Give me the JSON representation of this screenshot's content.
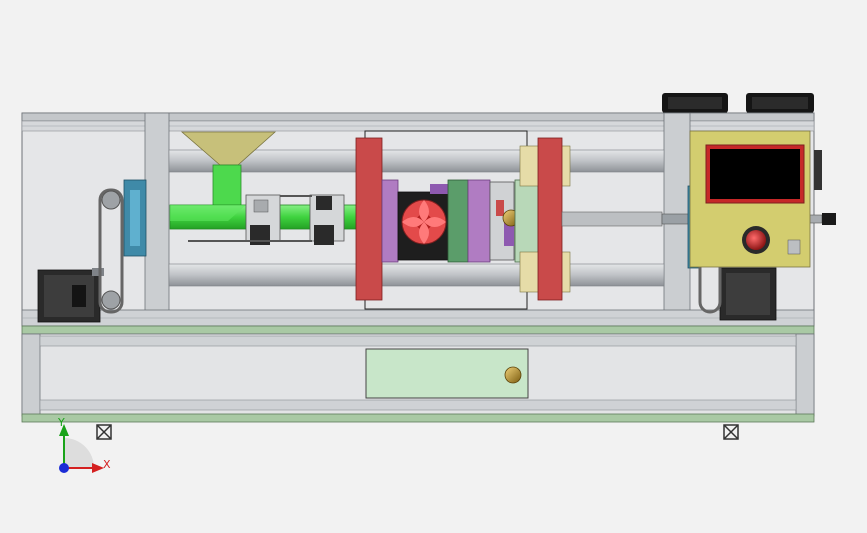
{
  "viewport": {
    "background": "#f2f2f2",
    "model": "injection-molding-machine-assembly"
  },
  "triad": {
    "x_label": "X",
    "y_label": "Y",
    "colors": {
      "x": "#d42020",
      "y": "#19a319",
      "z": "#1b2cd6"
    }
  },
  "colors": {
    "frame": "#b9bcc0",
    "frame_dark": "#7f8388",
    "base": "#a9c9a4",
    "rod": "#c9cbcf",
    "platen": "#c94a4a",
    "mold_purple": "#b07cc2",
    "mold_green": "#5b9d6a",
    "barrel": "#4dd94d",
    "hopper": "#c7c07a",
    "control_panel": "#d3cd6f",
    "screen": "#000000",
    "estop": "#c62828",
    "fan": "#1a1a1a",
    "knob": "#b8860b",
    "drawer": "#c8e6c9"
  }
}
